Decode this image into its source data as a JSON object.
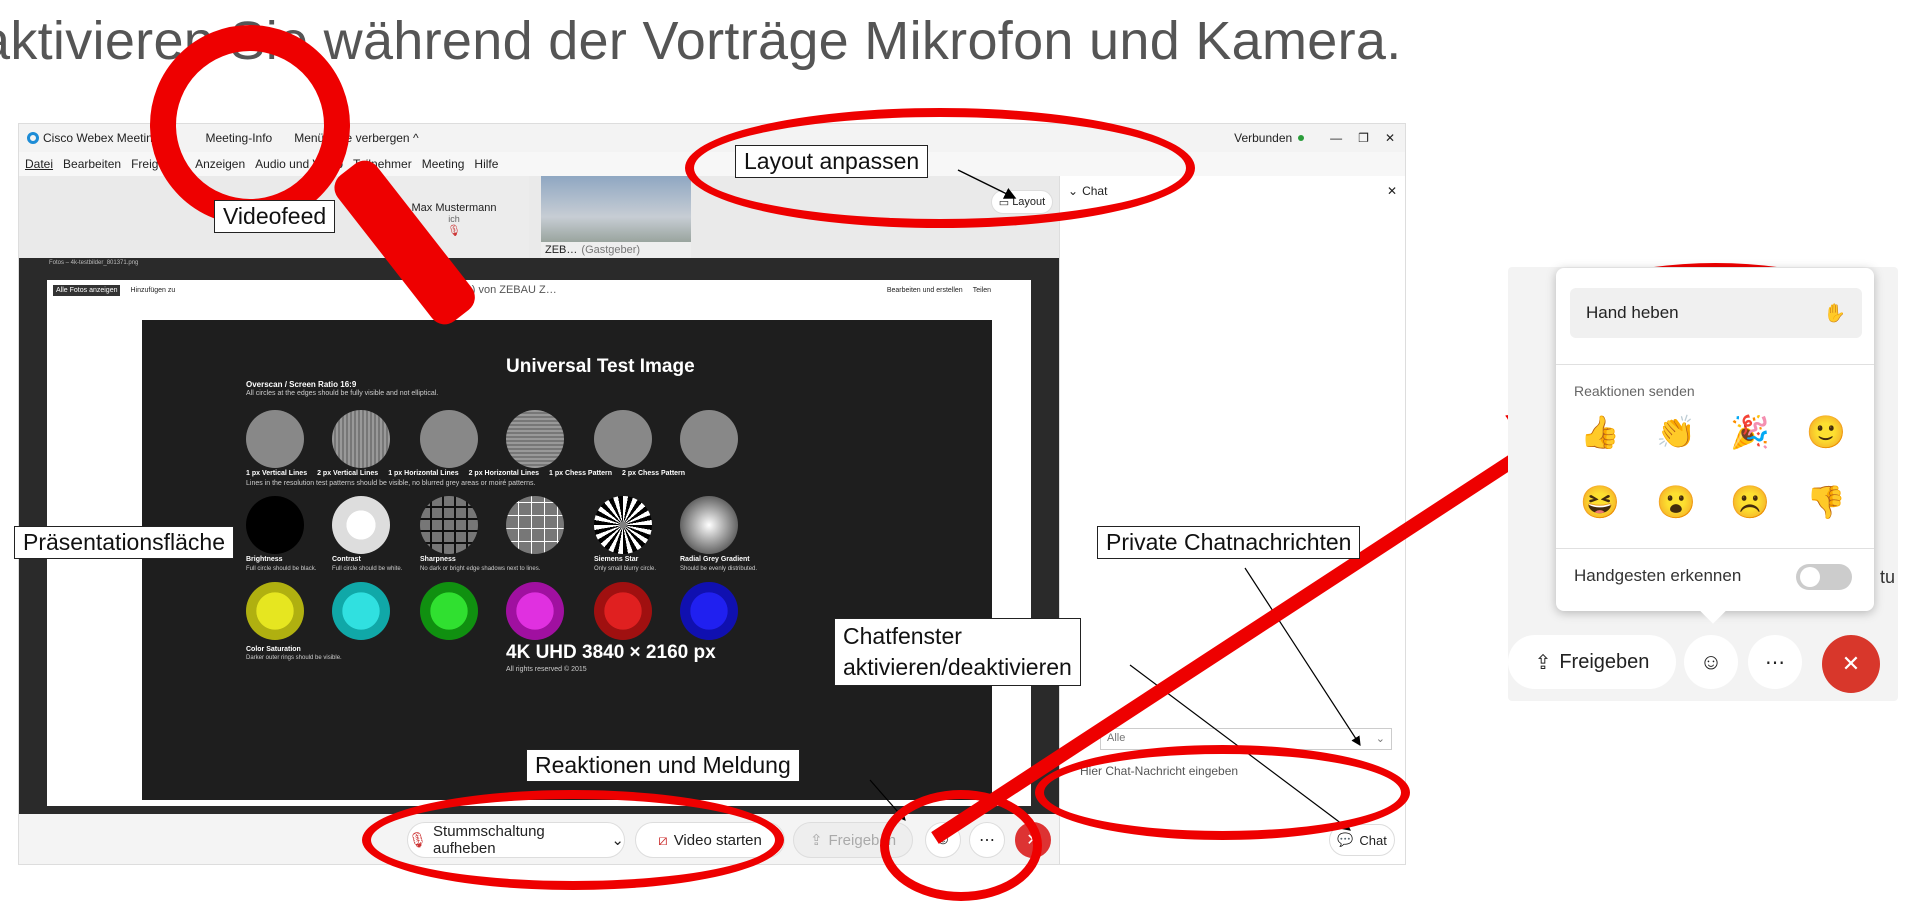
{
  "slide_title": "aktivieren Sie während der Vorträge Mikrofon und Kamera.",
  "window": {
    "app_title": "Cisco Webex Meetings",
    "meeting_info": "Meeting-Info",
    "hide_menu": "Menüleiste verbergen ^",
    "status": "Verbunden",
    "status_color": "#2a9d3a"
  },
  "menu": [
    "Datei",
    "Bearbeiten",
    "Freigeben",
    "Anzeigen",
    "Audio und Video",
    "Teilnehmer",
    "Meeting",
    "Hilfe"
  ],
  "participants": [
    {
      "name": "Max Mustermann",
      "sub": "ich"
    },
    {
      "name": "ZEB…",
      "sub": "(Gastgeber)"
    }
  ],
  "layout_button": "Layout",
  "sharing_label": "ndung(en) von ZEBAU Z…",
  "photo_app": {
    "file": "Fotos – 4k-testbilder_801371.png",
    "show_all": "Alle Fotos anzeigen",
    "add_to": "Hinzufügen zu",
    "edit": "Bearbeiten und erstellen",
    "share": "Teilen"
  },
  "test_image": {
    "title": "Universal Test Image",
    "overscan": "Overscan / Screen Ratio 16:9",
    "overscan_sub": "All circles at the edges should be fully visible and not elliptical.",
    "row1": [
      "1 px Vertical Lines",
      "2 px Vertical Lines",
      "1 px Horizontal Lines",
      "2 px Horizontal Lines",
      "1 px Chess Pattern",
      "2 px Chess Pattern"
    ],
    "row1_sub": "Lines in the resolution test patterns should be visible, no blurred grey areas or moiré patterns.",
    "row2": [
      "Brightness",
      "Contrast",
      "Sharpness",
      "",
      "Siemens Star",
      "Radial Grey Gradient"
    ],
    "row2_sub": [
      "Full circle should be black.",
      "Full circle should be white.",
      "No dark or bright edge shadows next to lines.",
      "",
      "Only small blurry circle.",
      "Should be evenly distributed."
    ],
    "saturation": "Color Saturation",
    "saturation_sub": "Darker outer rings should be visible.",
    "resolution": "4K UHD 3840 × 2160 px",
    "copyright": "All rights reserved © 2015",
    "colors": [
      "#d8d820",
      "#20d0d0",
      "#20c020",
      "#d020d0",
      "#d01818",
      "#1818e0"
    ]
  },
  "chat": {
    "header": "Chat",
    "to_label": "Alle",
    "input_placeholder": "Hier Chat-Nachricht eingeben",
    "chat_button": "Chat"
  },
  "controls": {
    "unmute": "Stummschaltung aufheben",
    "video": "Video starten",
    "share": "Freigeben"
  },
  "callouts": {
    "layout": "Layout anpassen",
    "videofeed": "Videofeed",
    "presentation": "Präsentationsfläche",
    "private_chat": "Private Chatnachrichten",
    "chat_window_1": "Chatfenster",
    "chat_window_2": "aktivieren/deaktivieren",
    "reactions": "Reaktionen und Meldung"
  },
  "reaction_popup": {
    "raise_hand": "Hand heben",
    "send_reactions": "Reaktionen senden",
    "emojis": [
      "👍",
      "👏",
      "🎉",
      "🙂",
      "😆",
      "😮",
      "☹️",
      "👎"
    ],
    "gesture_label": "Handgesten erkennen",
    "gesture_enabled": false,
    "share_button": "Freigeben",
    "clipped_text": "tu"
  },
  "annotation_color": "#e00000"
}
